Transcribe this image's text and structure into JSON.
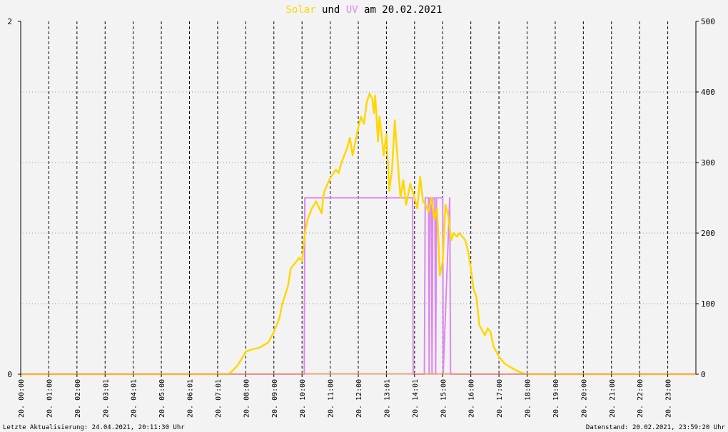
{
  "colors": {
    "background": "#f3f3f3",
    "solar": "#ffd700",
    "uv": "#dd88ee",
    "overlap": "#f0a070",
    "axis": "#000000",
    "text": "#000000"
  },
  "header": {
    "title_solar": "Solar",
    "title_und": "und",
    "title_uv": "UV",
    "title_rest": "am 20.02.2021"
  },
  "footer": {
    "left": "Letzte Aktualisierung: 24.04.2021, 20:11:30 Uhr",
    "right": "Datenstand: 20.02.2021, 23:59:20 Uhr"
  },
  "chart_data": {
    "type": "line",
    "x_unit": "hours",
    "xlim": [
      0,
      24
    ],
    "x_tick_labels": [
      "20. 00:00",
      "20. 01:00",
      "20. 02:00",
      "20. 03:01",
      "20. 04:01",
      "20. 05:00",
      "20. 06:01",
      "20. 07:01",
      "20. 08:00",
      "20. 09:00",
      "20. 10:00",
      "20. 11:00",
      "20. 12:00",
      "20. 13:01",
      "20. 14:01",
      "20. 15:00",
      "20. 16:00",
      "20. 17:00",
      "20. 18:00",
      "20. 19:00",
      "20. 20:00",
      "20. 21:00",
      "20. 22:00",
      "20. 23:00"
    ],
    "left_axis": {
      "ylim": [
        0,
        2
      ],
      "tick_labels": [
        "0",
        "2"
      ]
    },
    "right_axis": {
      "ylim": [
        0,
        500
      ],
      "tick_labels": [
        "0",
        "100",
        "200",
        "300",
        "400",
        "500"
      ]
    },
    "grid": true,
    "series": [
      {
        "name": "Solar",
        "axis": "right",
        "color": "#ffd700",
        "x": [
          0,
          7.4,
          7.7,
          7.9,
          8.0,
          8.2,
          8.5,
          8.8,
          9.0,
          9.2,
          9.3,
          9.5,
          9.6,
          9.8,
          9.9,
          10.0,
          10.1,
          10.2,
          10.3,
          10.35,
          10.5,
          10.7,
          10.75,
          10.8,
          11.0,
          11.2,
          11.3,
          11.4,
          11.6,
          11.7,
          11.8,
          12.0,
          12.1,
          12.2,
          12.3,
          12.4,
          12.5,
          12.55,
          12.6,
          12.7,
          12.75,
          12.8,
          12.9,
          13.0,
          13.05,
          13.1,
          13.2,
          13.3,
          13.35,
          13.5,
          13.6,
          13.7,
          13.8,
          13.85,
          14.0,
          14.1,
          14.2,
          14.3,
          14.4,
          14.5,
          14.6,
          14.7,
          14.8,
          14.9,
          15.0,
          15.1,
          15.2,
          15.3,
          15.4,
          15.5,
          15.6,
          15.8,
          15.9,
          16.0,
          16.1,
          16.2,
          16.3,
          16.5,
          16.6,
          16.7,
          16.8,
          17.0,
          17.2,
          17.5,
          17.8,
          18.0,
          24
        ],
        "y": [
          0,
          0,
          12,
          25,
          32,
          35,
          38,
          45,
          60,
          80,
          100,
          125,
          150,
          160,
          165,
          160,
          200,
          220,
          230,
          235,
          245,
          228,
          250,
          260,
          278,
          290,
          285,
          300,
          320,
          335,
          310,
          350,
          365,
          355,
          385,
          398,
          390,
          370,
          395,
          330,
          365,
          350,
          310,
          340,
          300,
          260,
          290,
          360,
          330,
          250,
          275,
          240,
          260,
          270,
          250,
          235,
          280,
          245,
          240,
          230,
          250,
          220,
          235,
          140,
          160,
          240,
          225,
          190,
          200,
          195,
          200,
          190,
          175,
          150,
          120,
          110,
          70,
          55,
          65,
          60,
          40,
          25,
          15,
          8,
          2,
          0,
          0
        ]
      },
      {
        "name": "UV",
        "axis": "left",
        "color": "#dd88ee",
        "x": [
          0,
          10.08,
          10.1,
          13.93,
          13.95,
          14.35,
          14.38,
          14.5,
          14.52,
          14.55,
          14.6,
          14.62,
          14.65,
          14.72,
          14.75,
          14.78,
          15.0,
          15.02,
          15.25,
          15.28,
          24
        ],
        "y": [
          0,
          0,
          1,
          1,
          0,
          0,
          1,
          1,
          0,
          1,
          1,
          0,
          1,
          1,
          0,
          1,
          1,
          0,
          1,
          0,
          0
        ]
      }
    ]
  }
}
